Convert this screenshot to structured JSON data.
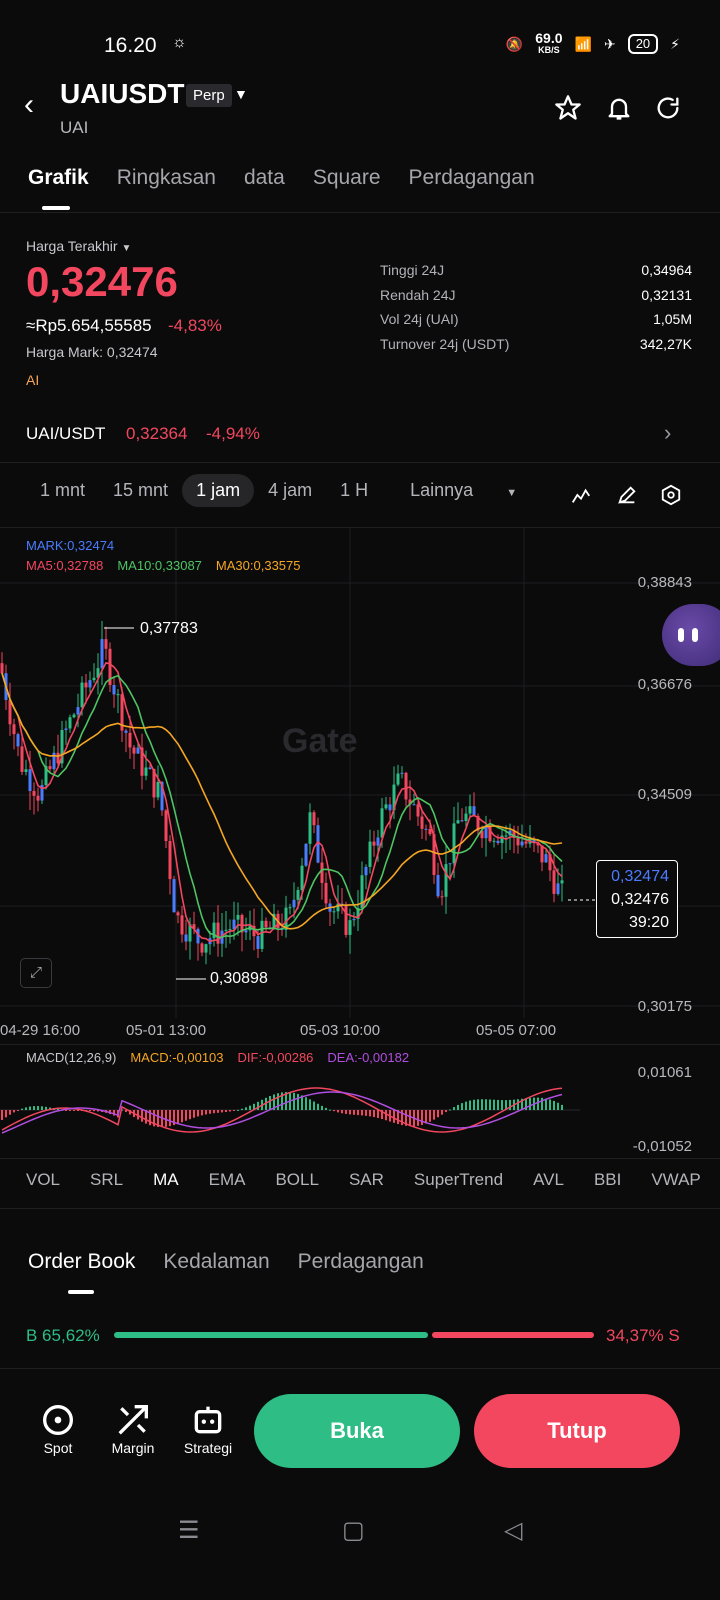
{
  "status_bar": {
    "time": "16.20",
    "speed": "69.0",
    "speed_unit": "KB/S",
    "battery": "20"
  },
  "header": {
    "symbol": "UAIUSDT",
    "badge": "Perp",
    "subtitle": "UAI"
  },
  "tabs": [
    "Grafik",
    "Ringkasan",
    "data",
    "Square",
    "Perdagangan"
  ],
  "price_panel": {
    "label": "Harga Terakhir",
    "last_price": "0,32476",
    "idr_value": "≈Rp5.654,55585",
    "change": "-4,83%",
    "mark_price": "Harga Mark: 0,32474",
    "ai_label": "AI",
    "stats": [
      {
        "k": "Tinggi 24J",
        "v": "0,34964"
      },
      {
        "k": "Rendah 24J",
        "v": "0,32131"
      },
      {
        "k": "Vol 24j (UAI)",
        "v": "1,05M"
      },
      {
        "k": "Turnover 24j (USDT)",
        "v": "342,27K"
      }
    ]
  },
  "spot_pair": {
    "name": "UAI/USDT",
    "price": "0,32364",
    "change": "-4,94%"
  },
  "intervals": [
    "1 mnt",
    "15 mnt",
    "1 jam",
    "4 jam",
    "1 H",
    "Lainnya"
  ],
  "active_interval": "1 jam",
  "chart": {
    "legend_mark": "MARK:0,32474",
    "legend_ma5": "MA5:0,32788",
    "legend_ma10": "MA10:0,33087",
    "legend_ma30": "MA30:0,33575",
    "y_ticks": [
      "0,38843",
      "0,36676",
      "0,34509",
      "0,30175"
    ],
    "x_ticks": [
      "04-29 16:00",
      "05-01 13:00",
      "05-03 10:00",
      "05-05 07:00"
    ],
    "high_label": "0,37783",
    "low_label": "0,30898",
    "box_mark": "0,32474",
    "box_last": "0,32476",
    "box_countdown": "39:20",
    "watermark": "Gate",
    "colors": {
      "up": "#2ebd85",
      "down": "#f2475e",
      "ma5": "#f2475e",
      "ma10": "#4fc463",
      "ma30": "#f5a623",
      "mark": "#4b7cff"
    }
  },
  "macd": {
    "label": "MACD(12,26,9)",
    "macd": "MACD:-0,00103",
    "dif": "DIF:-0,00286",
    "dea": "DEA:-0,00182",
    "y_top": "0,01061",
    "y_bottom": "-0,01052"
  },
  "indicators": [
    "VOL",
    "SRL",
    "MA",
    "EMA",
    "BOLL",
    "SAR",
    "SuperTrend",
    "AVL",
    "BBI",
    "VWAP"
  ],
  "active_indicator": "MA",
  "order_book": {
    "tabs": [
      "Order Book",
      "Kedalaman",
      "Perdagangan"
    ],
    "buy_pct_label": "B 65,62%",
    "sell_pct_label": "34,37% S",
    "buy_fraction": 0.6562
  },
  "bottom_bar": {
    "spot": "Spot",
    "margin": "Margin",
    "strategy": "Strategi",
    "open": "Buka",
    "close": "Tutup"
  }
}
